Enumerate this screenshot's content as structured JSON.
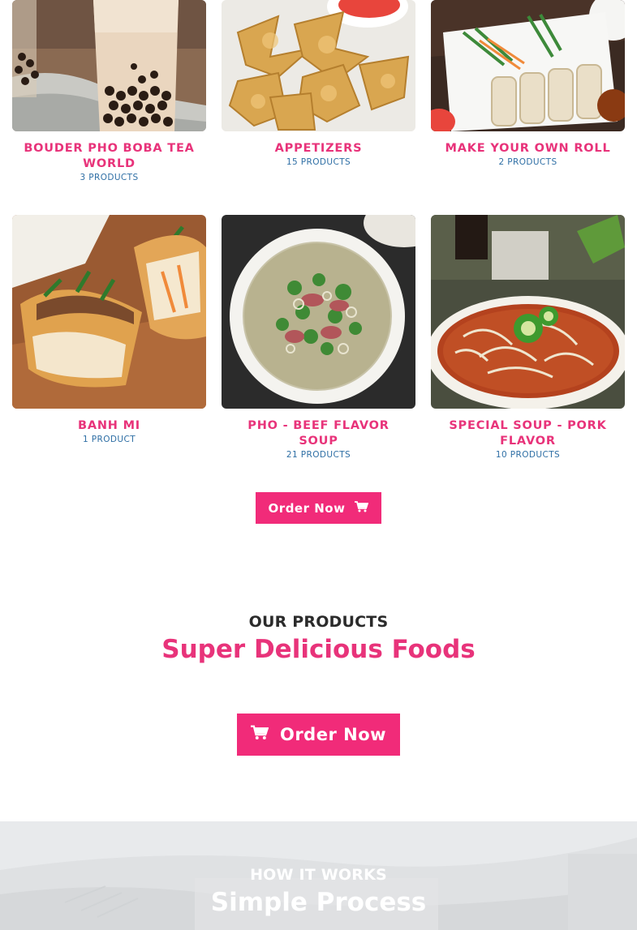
{
  "categories": [
    {
      "title": "BOUDER PHO BOBA TEA WORLD",
      "count": "3 PRODUCTS",
      "image": "boba-tea-photo"
    },
    {
      "title": "APPETIZERS",
      "count": "15 PRODUCTS",
      "image": "fried-wontons-photo"
    },
    {
      "title": "MAKE YOUR OWN ROLL",
      "count": "2 PRODUCTS",
      "image": "spring-rolls-photo"
    },
    {
      "title": "BANH MI",
      "count": "1 PRODUCT",
      "image": "banh-mi-sandwich-photo"
    },
    {
      "title": "PHO - BEEF FLAVOR SOUP",
      "count": "21 PRODUCTS",
      "image": "pho-beef-soup-photo"
    },
    {
      "title": "SPECIAL SOUP - PORK FLAVOR",
      "count": "10 PRODUCTS",
      "image": "spicy-pork-soup-photo"
    }
  ],
  "order_button_small": {
    "label": "Order Now",
    "icon": "cart-icon"
  },
  "products_section": {
    "eyebrow": "OUR PRODUCTS",
    "headline": "Super Delicious Foods",
    "button": {
      "label": "Order Now",
      "icon": "cart-icon"
    }
  },
  "how_section": {
    "eyebrow": "HOW IT WORKS",
    "headline": "Simple Process"
  },
  "colors": {
    "accent": "#f12b79",
    "title_pink": "#e8337a",
    "count_blue": "#2f6fa5",
    "heading_dark": "#2b2b2b"
  }
}
